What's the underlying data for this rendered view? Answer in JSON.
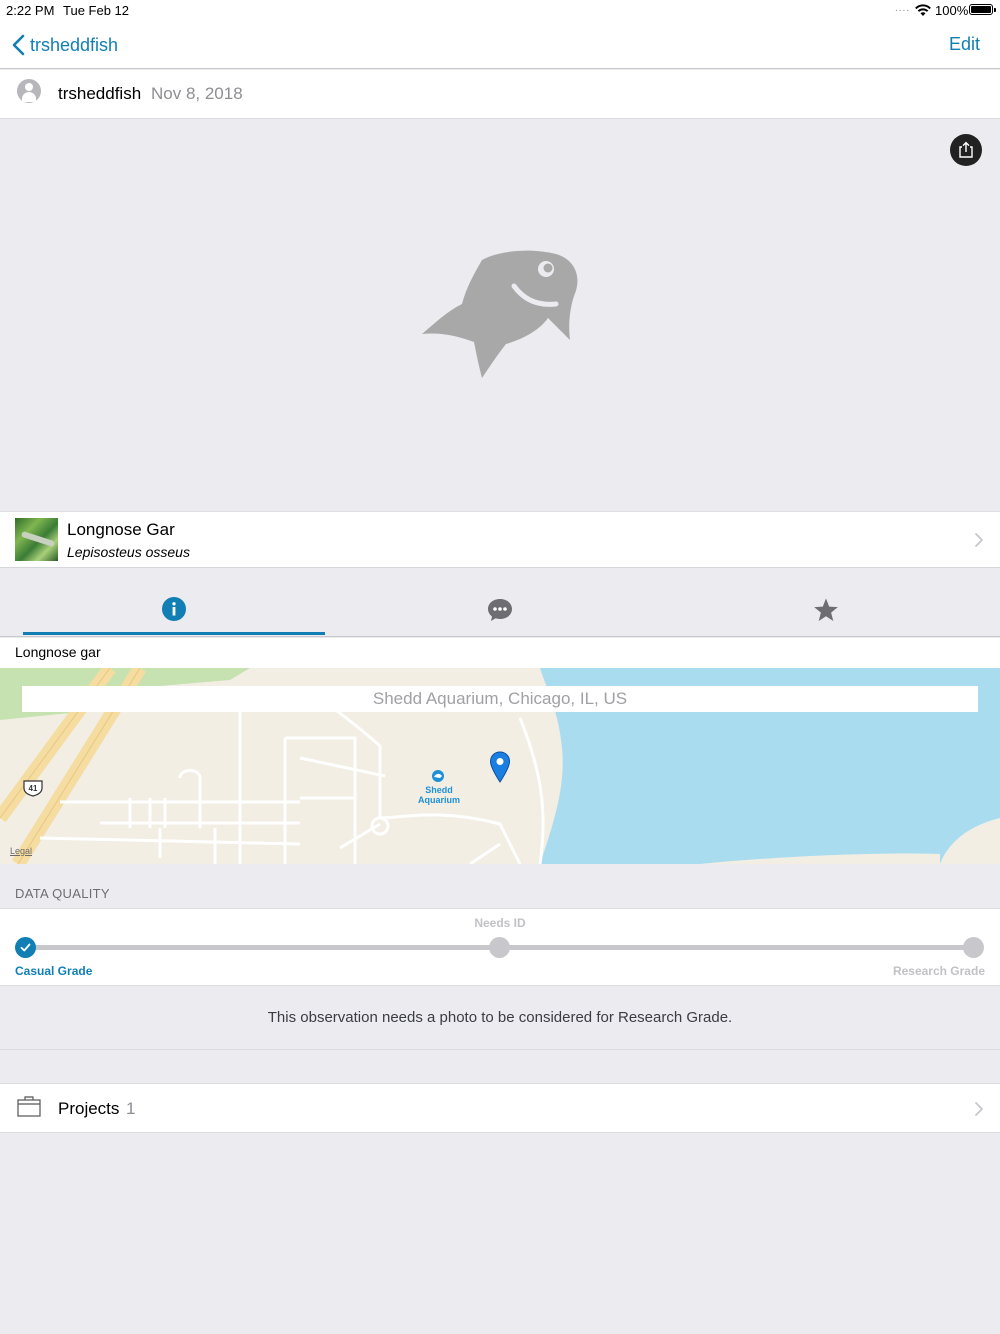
{
  "status_bar": {
    "time": "2:22 PM",
    "date": "Tue Feb 12",
    "signal": "....",
    "battery": "100%"
  },
  "nav": {
    "back_label": "trsheddfish",
    "edit_label": "Edit"
  },
  "observer": {
    "username": "trsheddfish",
    "date": "Nov 8, 2018"
  },
  "taxon": {
    "common_name": "Longnose Gar",
    "scientific_name": "Lepisosteus osseus"
  },
  "tabs": [
    {
      "name": "info",
      "icon": "info-icon",
      "active": true
    },
    {
      "name": "activity",
      "icon": "speech-bubble-icon",
      "active": false
    },
    {
      "name": "favorites",
      "icon": "star-icon",
      "active": false
    }
  ],
  "notes": "Longnose gar",
  "map": {
    "place_guess": "Shedd Aquarium, Chicago, IL, US",
    "poi_name": "Shedd Aquarium",
    "highway_shield": "41",
    "legal": "Legal",
    "water_color": "#aadcf0"
  },
  "data_quality": {
    "header": "DATA QUALITY",
    "steps": [
      "Casual Grade",
      "Needs ID",
      "Research Grade"
    ],
    "current": "Casual Grade",
    "note": "This observation needs a photo to be considered for Research Grade."
  },
  "projects": {
    "label": "Projects",
    "count": "1"
  },
  "colors": {
    "accent": "#117fb4",
    "background": "#ebebf0",
    "placeholder_fish": "#a8a8a8"
  }
}
